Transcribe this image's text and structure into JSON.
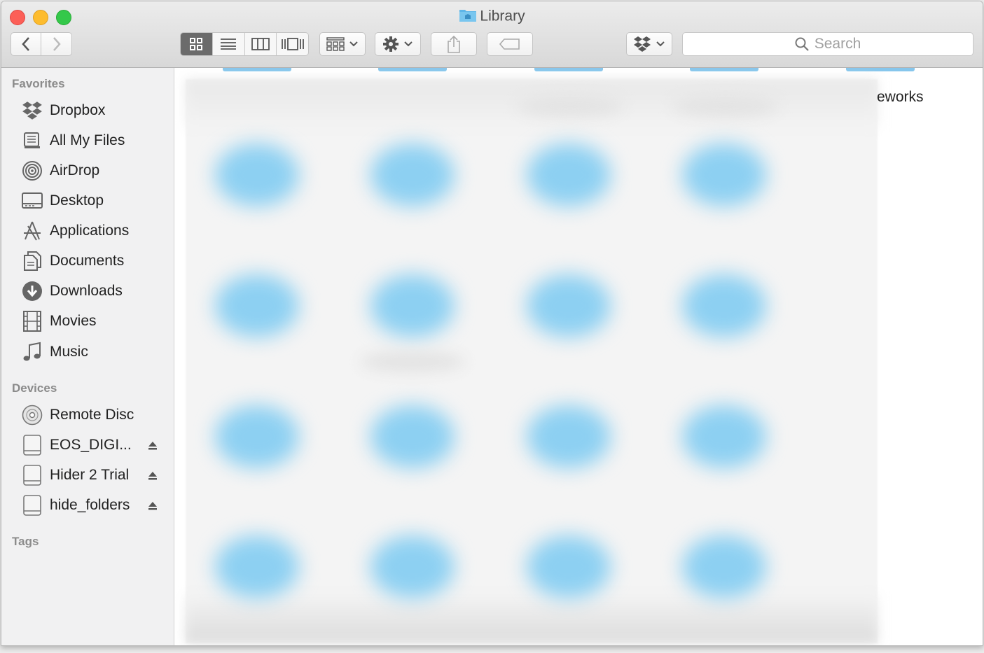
{
  "window": {
    "title": "Library",
    "colors": {
      "close": "#fc5f57",
      "minimize": "#fdbc2e",
      "zoom": "#34c84a",
      "folder_accent": "#8dd0f2"
    }
  },
  "toolbar": {
    "nav": [
      "back-icon",
      "forward-icon"
    ],
    "view_modes": [
      "icon-view-icon",
      "list-view-icon",
      "column-view-icon",
      "cover-flow-icon"
    ],
    "active_view": "icon-view-icon",
    "arrange_icon": "arrange-icon",
    "action_icon": "gear-icon",
    "share_icon": "share-icon",
    "tag_icon": "tag-icon",
    "dropbox_icon": "dropbox-icon",
    "search_placeholder": "Search"
  },
  "sidebar": {
    "favorites_header": "Favorites",
    "favorites": [
      {
        "label": "Dropbox",
        "icon": "dropbox-icon"
      },
      {
        "label": "All My Files",
        "icon": "all-files-icon"
      },
      {
        "label": "AirDrop",
        "icon": "airdrop-icon"
      },
      {
        "label": "Desktop",
        "icon": "desktop-icon"
      },
      {
        "label": "Applications",
        "icon": "applications-icon"
      },
      {
        "label": "Documents",
        "icon": "documents-icon"
      },
      {
        "label": "Downloads",
        "icon": "downloads-icon"
      },
      {
        "label": "Movies",
        "icon": "movies-icon"
      },
      {
        "label": "Music",
        "icon": "music-icon"
      }
    ],
    "devices_header": "Devices",
    "devices": [
      {
        "label": "Remote Disc",
        "icon": "disc-icon"
      },
      {
        "label": "EOS_DIGI...",
        "icon": "drive-icon"
      },
      {
        "label": "Hider 2 Trial",
        "icon": "drive-icon"
      },
      {
        "label": "hide_folders",
        "icon": "drive-icon"
      }
    ],
    "tags_header": "Tags"
  },
  "content": {
    "partial_label": "eworks"
  }
}
